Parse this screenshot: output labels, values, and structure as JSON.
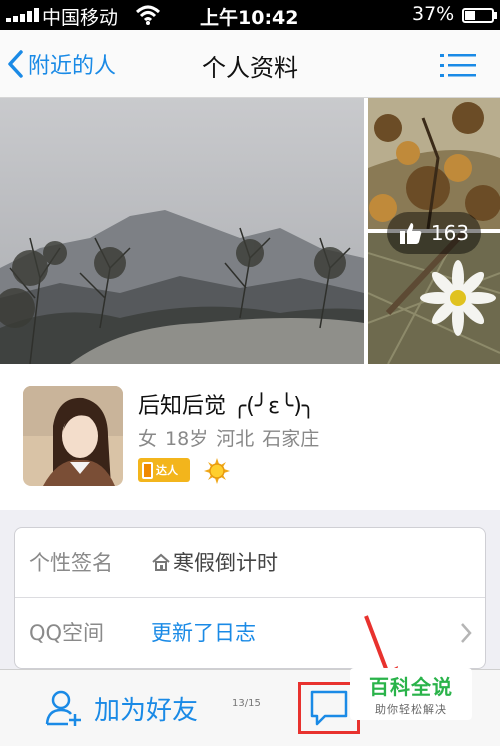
{
  "status_bar": {
    "carrier": "中国移动",
    "time": "上午10:42",
    "battery_percent": "37%",
    "battery_level": 0.37,
    "signal_bars": 5,
    "wifi_icon": "wifi-icon"
  },
  "nav": {
    "back_label": "附近的人",
    "title": "个人资料",
    "menu_icon": "list-menu-icon"
  },
  "photos": {
    "like_count": "163",
    "like_icon": "thumbs-up-icon"
  },
  "profile": {
    "nickname": "后知后觉 ╭(╯ε╰)╮",
    "info": "女  18岁  河北 石家庄",
    "badge_label": "达人",
    "sun_badge_icon": "sun-level-icon"
  },
  "info_rows": [
    {
      "label": "个性签名",
      "value": "寒假倒计时"
    },
    {
      "label": "QQ空间",
      "value": "更新了日志"
    }
  ],
  "bottom_bar": {
    "add_friend_label": "加为好友",
    "page_counter": "13/15",
    "chat_icon": "chat-bubble-icon"
  },
  "watermark": {
    "title": "百科全说",
    "subtitle": "助你轻松解决"
  },
  "colors": {
    "accent": "#1a8ae6",
    "highlight": "#e8322e",
    "watermark_green": "#2ab34a"
  }
}
